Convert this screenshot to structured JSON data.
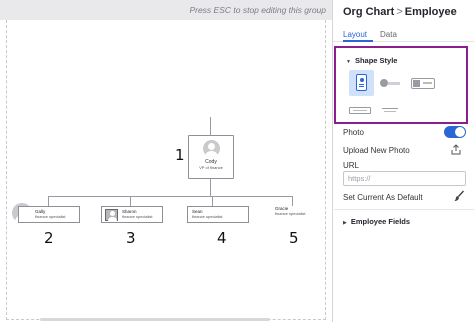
{
  "canvas": {
    "esc_hint": "Press ESC to stop editing this group",
    "root": {
      "name": "Cody",
      "title": "VP of finance"
    },
    "children": [
      {
        "name": "Gally",
        "title": "finance specialist"
      },
      {
        "name": "Sharon",
        "title": "finance specialist"
      },
      {
        "name": "Sean",
        "title": "finance specialist"
      },
      {
        "name": "Gracie",
        "title": "finance specialist"
      }
    ],
    "annotations": [
      "1",
      "2",
      "3",
      "4",
      "5"
    ]
  },
  "panel": {
    "breadcrumb": {
      "parent": "Org Chart",
      "separator": ">",
      "current": "Employee"
    },
    "tabs": [
      {
        "label": "Layout",
        "active": true
      },
      {
        "label": "Data",
        "active": false
      }
    ],
    "shape_style": {
      "label": "Shape Style",
      "selected_option": "card-vertical-photo",
      "highlight_color": "#8a1e8f"
    },
    "photo": {
      "label": "Photo",
      "enabled": true
    },
    "upload_photo": {
      "label": "Upload New Photo"
    },
    "url": {
      "label": "URL",
      "placeholder": "https://",
      "value": ""
    },
    "set_default": {
      "label": "Set Current As Default"
    },
    "employee_fields": {
      "label": "Employee Fields"
    },
    "accent_color": "#2a66d6"
  }
}
